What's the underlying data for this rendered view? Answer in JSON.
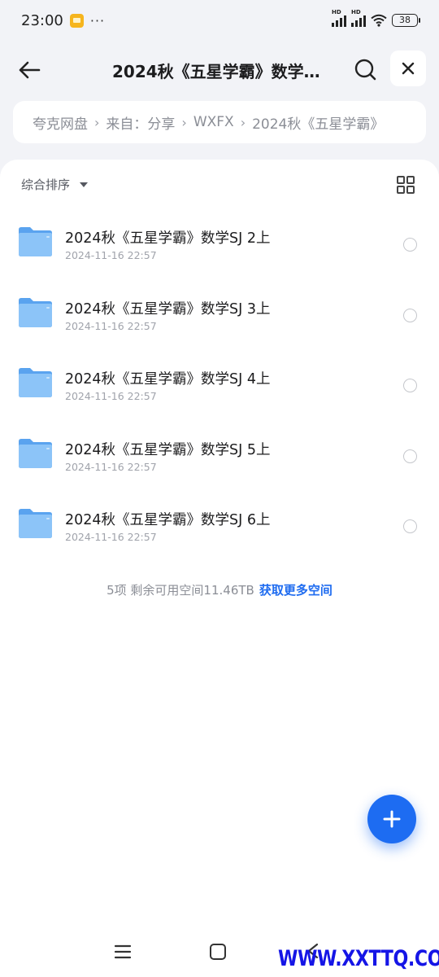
{
  "status_bar": {
    "time": "23:00",
    "dots": "···",
    "battery": "38"
  },
  "header": {
    "title": "2024秋《五星学霸》数学…"
  },
  "breadcrumb": [
    "夸克网盘",
    "来自：分享",
    "WXFX",
    "2024秋《五星学霸》"
  ],
  "breadcrumb_separator": "›",
  "sort": {
    "label": "综合排序"
  },
  "files": [
    {
      "name": "2024秋《五星学霸》数学SJ 2上",
      "date": "2024-11-16 22:57"
    },
    {
      "name": "2024秋《五星学霸》数学SJ 3上",
      "date": "2024-11-16 22:57"
    },
    {
      "name": "2024秋《五星学霸》数学SJ 4上",
      "date": "2024-11-16 22:57"
    },
    {
      "name": "2024秋《五星学霸》数学SJ 5上",
      "date": "2024-11-16 22:57"
    },
    {
      "name": "2024秋《五星学霸》数学SJ 6上",
      "date": "2024-11-16 22:57"
    }
  ],
  "footer": {
    "summary": "5项  剩余可用空间11.46TB",
    "link": "获取更多空间"
  },
  "watermark": "WWW.XXTTQ.COM",
  "colors": {
    "accent": "#1d6cf2",
    "folder": "#6fb2f5",
    "background": "#f2f3f7"
  }
}
